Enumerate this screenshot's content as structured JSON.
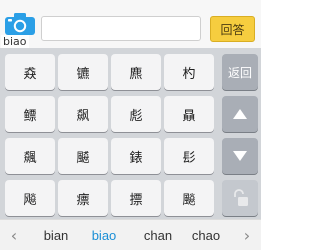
{
  "top_bar": {
    "camera_label": "biao",
    "input_value": "",
    "answer_button": "回答"
  },
  "keyboard": {
    "rows": [
      [
        "猋",
        "镳",
        "麃",
        "杓"
      ],
      [
        "鳔",
        "飙",
        "彪",
        "贔"
      ],
      [
        "飆",
        "飇",
        "錶",
        "髟"
      ],
      [
        "飚",
        "瘭",
        "摽",
        "飈"
      ]
    ],
    "return_key": "返回",
    "icons": {
      "up": "up-arrow-icon",
      "down": "down-arrow-icon",
      "lock": "lock-icon"
    }
  },
  "candidates": {
    "items": [
      "bian",
      "biao",
      "chan",
      "chao"
    ],
    "selected": "biao",
    "icons": {
      "prev": "chevron-left-icon",
      "next": "chevron-right-icon"
    }
  },
  "colors": {
    "answer_button": "#f6cd3f",
    "keyboard_bg": "#d2d5d9",
    "side_key": "#a9aeb6",
    "selected_candidate": "#1a8fd6"
  }
}
